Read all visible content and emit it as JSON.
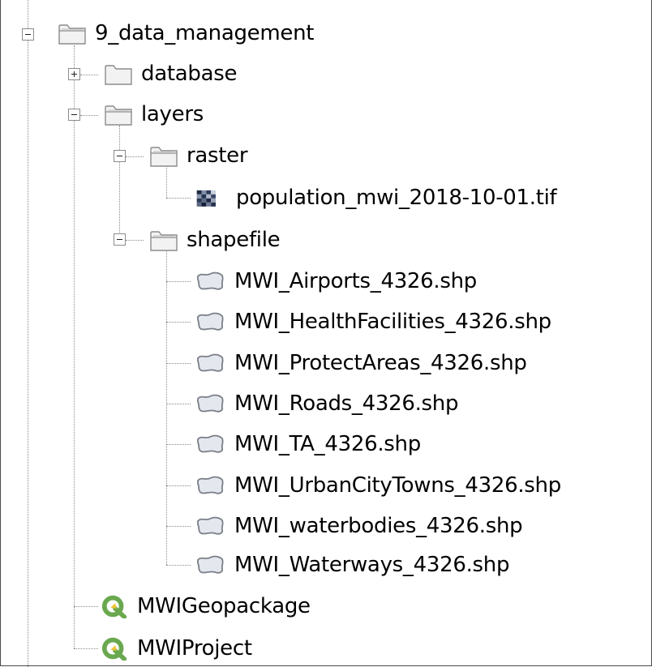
{
  "tree": {
    "root": {
      "label": "9_data_management",
      "icon": "folder-open-icon",
      "expanded": true
    },
    "database": {
      "label": "database",
      "icon": "folder-icon",
      "expanded": false
    },
    "layers": {
      "label": "layers",
      "icon": "folder-open-icon",
      "expanded": true
    },
    "raster": {
      "label": "raster",
      "icon": "folder-open-icon",
      "expanded": true
    },
    "raster_file": {
      "label": "population_mwi_2018-10-01.tif",
      "icon": "raster-layer-icon"
    },
    "shapefile": {
      "label": "shapefile",
      "icon": "folder-open-icon",
      "expanded": true
    },
    "shapefiles": [
      {
        "label": "MWI_Airports_4326.shp",
        "icon": "polygon-layer-icon"
      },
      {
        "label": "MWI_HealthFacilities_4326.shp",
        "icon": "polygon-layer-icon"
      },
      {
        "label": "MWI_ProtectAreas_4326.shp",
        "icon": "polygon-layer-icon"
      },
      {
        "label": "MWI_Roads_4326.shp",
        "icon": "polygon-layer-icon"
      },
      {
        "label": "MWI_TA_4326.shp",
        "icon": "polygon-layer-icon"
      },
      {
        "label": "MWI_UrbanCityTowns_4326.shp",
        "icon": "polygon-layer-icon"
      },
      {
        "label": "MWI_waterbodies_4326.shp",
        "icon": "polygon-layer-icon"
      },
      {
        "label": "MWI_Waterways_4326.shp",
        "icon": "polygon-layer-icon"
      }
    ],
    "geopackage": {
      "label": "MWIGeopackage",
      "icon": "qgis-icon"
    },
    "project": {
      "label": "MWIProject",
      "icon": "qgis-icon"
    }
  },
  "colors": {
    "folder_fill": "#f2f2f2",
    "folder_stroke": "#8c8c8c",
    "qgis_green": "#6aa84f",
    "qgis_yellow": "#f1c232",
    "polygon_fill": "#e4e8ee",
    "polygon_stroke": "#7a7f88"
  }
}
